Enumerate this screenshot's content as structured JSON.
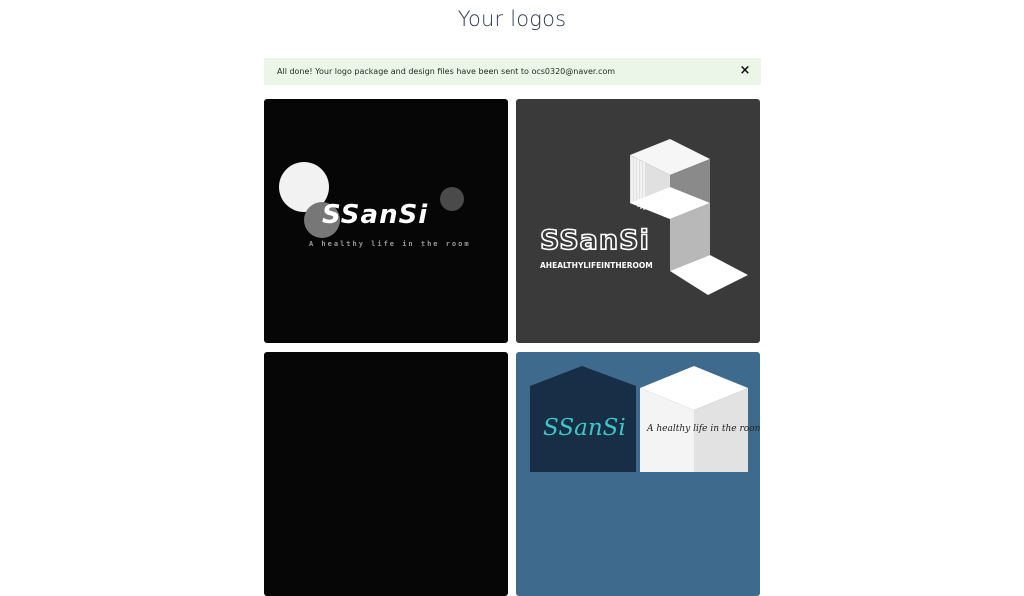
{
  "page": {
    "title": "Your logos"
  },
  "alert": {
    "message": "All done! Your logo package and design files have been sent to ocs0320@naver.com",
    "close_icon": "×"
  },
  "logos": [
    {
      "brand": "SSanSi",
      "tagline": "A healthy life in the room",
      "background": "#060606"
    },
    {
      "brand": "SSanSi",
      "tagline": "AHEALTHYLIFEINTHEROOM",
      "background": "#3b3a3b"
    },
    {
      "background": "#060606"
    },
    {
      "brand": "SSanSi",
      "tagline": "A healthy life in the room",
      "background": "#3e6a8e"
    }
  ]
}
